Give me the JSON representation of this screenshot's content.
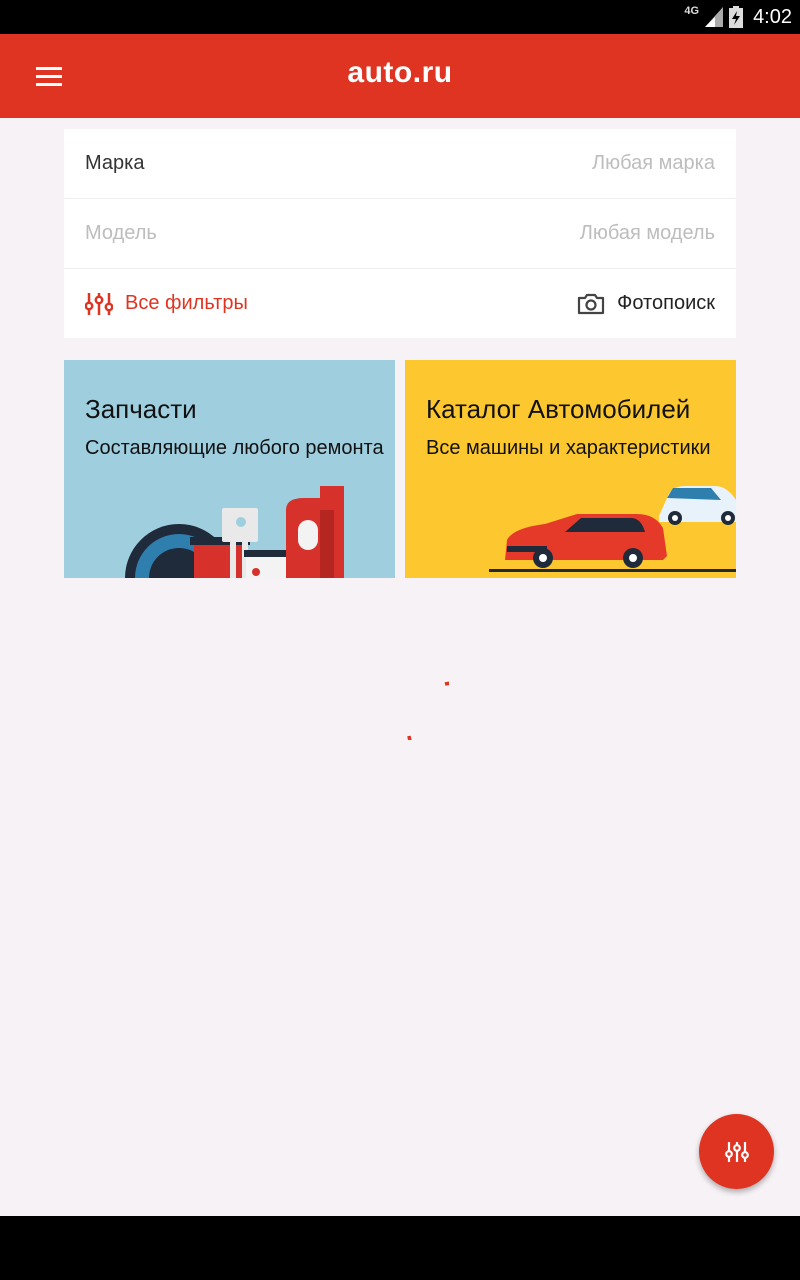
{
  "status_bar": {
    "network": "4G",
    "time": "4:02",
    "icons": [
      "signal-icon",
      "battery-icon"
    ]
  },
  "app_bar": {
    "menu_icon": "menu-icon",
    "logo": "auto.ru",
    "color": "#e03422"
  },
  "search": {
    "brand_label": "Марка",
    "brand_value": "Любая марка",
    "model_label": "Модель",
    "model_value": "Любая модель",
    "filters_label": "Все фильтры",
    "filters_icon": "sliders-icon",
    "photo_label": "Фотопоиск",
    "photo_icon": "camera-icon"
  },
  "tiles": [
    {
      "title": "Запчасти",
      "subtitle": "Составляющие любого ремонта",
      "color": "#9fcfdf"
    },
    {
      "title": "Каталог Автомобилей",
      "subtitle": "Все машины и характеристики",
      "color": "#fdc82f"
    }
  ],
  "loading": {
    "icon": "loading-spinner"
  },
  "fab": {
    "icon": "sliders-icon"
  }
}
